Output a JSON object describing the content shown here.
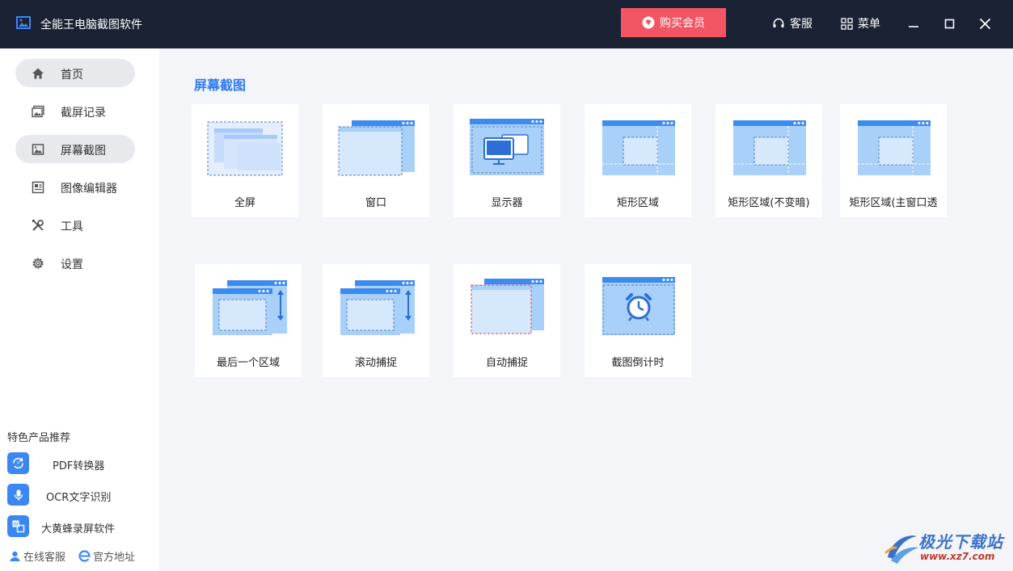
{
  "window": {
    "title": "全能王电脑截图软件",
    "vip_label": "购买会员",
    "service_label": "客服",
    "menu_label": "菜单"
  },
  "sidebar": {
    "items": [
      {
        "label": "首页",
        "icon": "home-icon",
        "active": true
      },
      {
        "label": "截屏记录",
        "icon": "gallery-icon",
        "active": false
      },
      {
        "label": "屏幕截图",
        "icon": "picture-icon",
        "active": true
      },
      {
        "label": "图像编辑器",
        "icon": "editor-icon",
        "active": false
      },
      {
        "label": "工具",
        "icon": "tools-icon",
        "active": false
      },
      {
        "label": "设置",
        "icon": "gear-icon",
        "active": false
      }
    ],
    "promo_title": "特色产品推荐",
    "promos": [
      {
        "label": "PDF转换器",
        "icon": "pdf-convert-icon"
      },
      {
        "label": "OCR文字识别",
        "icon": "microphone-icon"
      },
      {
        "label": "大黄蜂录屏软件",
        "icon": "recorder-icon"
      }
    ],
    "online_service": "在线客服",
    "official_site": "官方地址"
  },
  "main": {
    "section_title": "屏幕截图",
    "cards": [
      {
        "label": "全屏",
        "icon": "fullscreen-capture-icon"
      },
      {
        "label": "窗口",
        "icon": "window-capture-icon"
      },
      {
        "label": "显示器",
        "icon": "monitor-capture-icon"
      },
      {
        "label": "矩形区域",
        "icon": "rect-region-icon"
      },
      {
        "label": "矩形区域(不变暗)",
        "icon": "rect-region-nodim-icon"
      },
      {
        "label": "矩形区域(主窗口透",
        "icon": "rect-region-transparent-icon"
      },
      {
        "label": "最后一个区域",
        "icon": "last-region-icon"
      },
      {
        "label": "滚动捕捉",
        "icon": "scroll-capture-icon"
      },
      {
        "label": "自动捕捉",
        "icon": "auto-capture-icon"
      },
      {
        "label": "截图倒计时",
        "icon": "timer-capture-icon"
      }
    ]
  },
  "watermark": {
    "brand": "极光下载站",
    "url": "www.xz7.com"
  },
  "colors": {
    "titlebar": "#1b2233",
    "accent": "#2e7bf0",
    "vip": "#f25563",
    "illustration": "#9dcbf7",
    "illustration_dark": "#3e8bf0"
  }
}
